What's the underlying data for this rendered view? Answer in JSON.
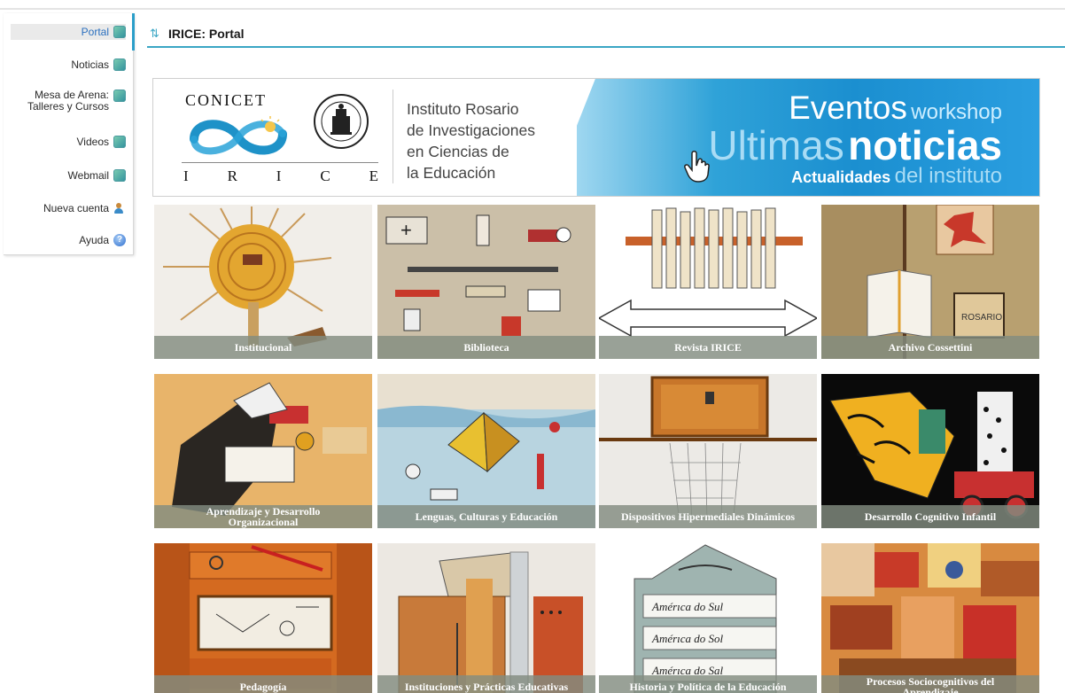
{
  "sidebar": {
    "items": [
      {
        "label": "Portal",
        "icon": "portal-icon",
        "active": true
      },
      {
        "label": "Noticias",
        "icon": "news-icon"
      },
      {
        "label": "Mesa de Arena:",
        "label2": "Talleres y Cursos",
        "icon": "workshop-icon"
      },
      {
        "label": "Videos",
        "icon": "video-icon"
      },
      {
        "label": "Webmail",
        "icon": "mail-icon"
      },
      {
        "label": "Nueva cuenta",
        "icon": "user-add-icon"
      },
      {
        "label": "Ayuda",
        "icon": "help-icon"
      }
    ]
  },
  "header": {
    "title": "IRICE: Portal",
    "icon": "refresh-icon"
  },
  "banner": {
    "conicet": "CONICET",
    "irice": [
      "I",
      "R",
      "I",
      "C",
      "E"
    ],
    "institute": [
      "Instituto Rosario",
      "de Investigaciones",
      "en Ciencias de",
      "la Educación"
    ],
    "line1_a": "Eventos",
    "line1_b": "workshop",
    "line2_a": "Ultimas",
    "line2_b": "noticias",
    "line3_a": "Actualidades",
    "line3_b": "del instituto",
    "accent": "#1b8fd0"
  },
  "tiles": [
    {
      "caption": "Institucional"
    },
    {
      "caption": "Biblioteca"
    },
    {
      "caption": "Revista IRICE"
    },
    {
      "caption": "Archivo Cossettini"
    },
    {
      "caption": "Aprendizaje y Desarrollo Organizacional"
    },
    {
      "caption": "Lenguas, Culturas y Educación"
    },
    {
      "caption": "Dispositivos Hipermediales Dinámicos"
    },
    {
      "caption": "Desarrollo Cognitivo Infantil"
    },
    {
      "caption": "Pedagogía"
    },
    {
      "caption": "Instituciones y Prácticas Educativas"
    },
    {
      "caption": "Historia y Política de la Educación"
    },
    {
      "caption": "Procesos Sociocognitivos del Aprendizaje"
    }
  ]
}
